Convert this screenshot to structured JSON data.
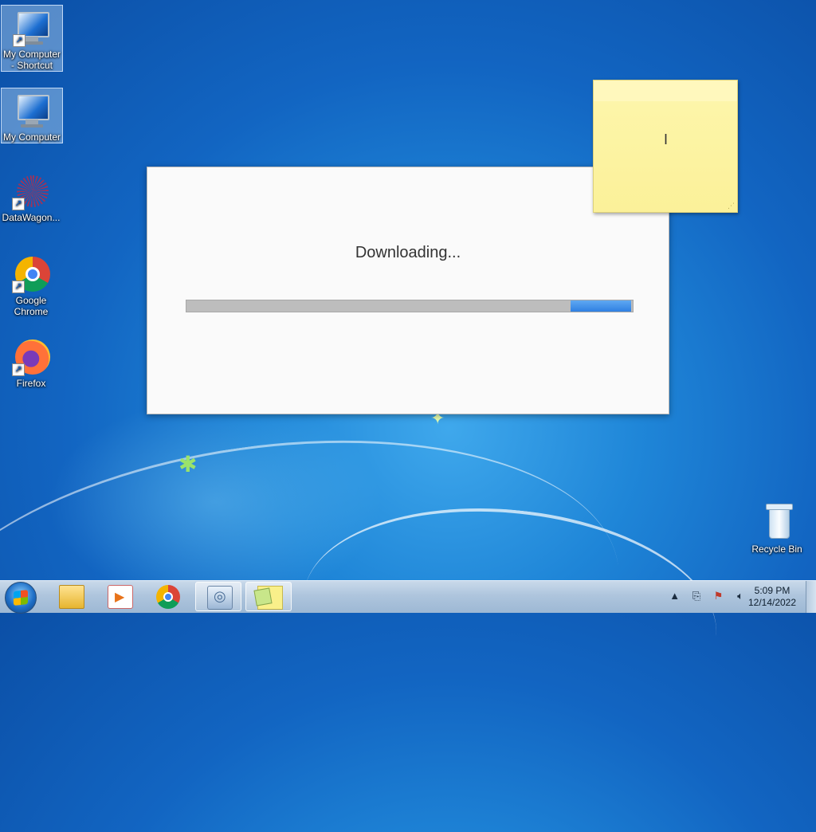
{
  "desktop": {
    "icons": [
      {
        "label": "My Computer - Shortcut"
      },
      {
        "label": "My Computer"
      },
      {
        "label": "DataWagon..."
      },
      {
        "label": "Google Chrome"
      },
      {
        "label": "Firefox"
      },
      {
        "label": "Recycle Bin"
      }
    ]
  },
  "dialog": {
    "status": "Downloading...",
    "progress_style": "marquee"
  },
  "sticky_note": {
    "text": ""
  },
  "taskbar": {
    "pinned": [
      {
        "icon": "folder-icon"
      },
      {
        "icon": "media-player-icon"
      },
      {
        "icon": "chrome-icon"
      },
      {
        "icon": "installer-icon"
      },
      {
        "icon": "sticky-notes-icon"
      }
    ],
    "tray_icons": [
      "show-hidden-icons-arrow",
      "network-icon",
      "action-center-flag-icon",
      "volume-icon"
    ],
    "clock": {
      "time": "5:09 PM",
      "date": "12/14/2022"
    }
  },
  "colors": {
    "progress_chunk": "#2f80e2",
    "progress_track": "#bdbdbd",
    "sticky": "#fbf199"
  }
}
